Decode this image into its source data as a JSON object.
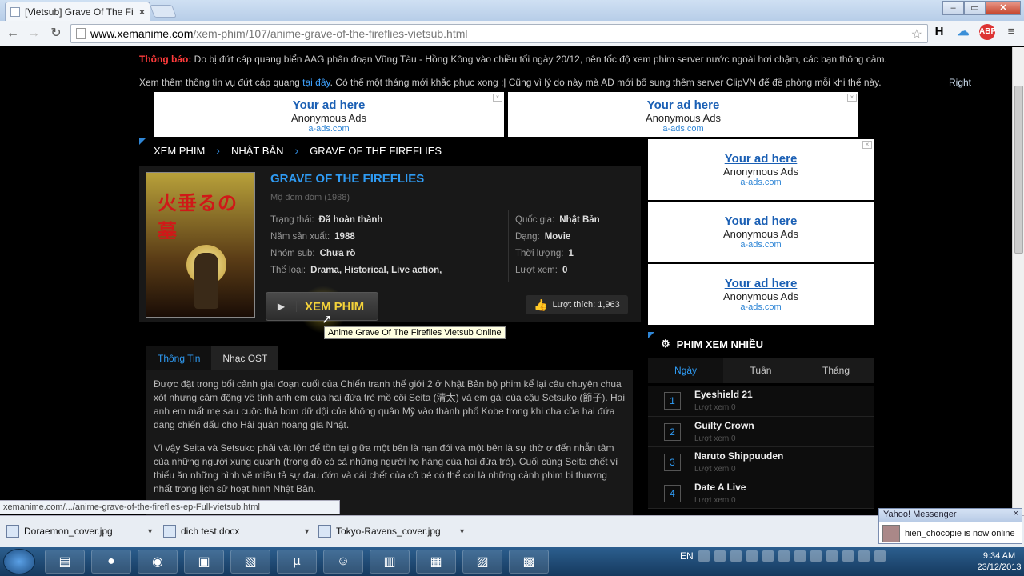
{
  "browser": {
    "tab_title": "[Vietsub] Grave Of The Fireflies",
    "url_host": "www.xemanime.com",
    "url_path": "/xem-phim/107/anime-grave-of-the-fireflies-vietsub.html",
    "window_buttons": [
      "–",
      "▭",
      "✕"
    ]
  },
  "notice": {
    "label": "Thông báo:",
    "text": "Do bị đứt cáp quang biển AAG phân đoạn Vũng Tàu - Hồng Kông vào chiều tối ngày 20/12, nên tốc độ xem phim server nước ngoài hơi chậm, các bạn thông cảm.",
    "line2_before": "Xem thêm thông tin vụ đứt cáp quang ",
    "line2_link": "tại đây",
    "line2_after": ". Có thể một tháng mới khắc phục xong :| Cũng vì lý do này mà AD mới bổ sung thêm server ClipVN để đề phòng mỗi khi thế này.",
    "right_label": "Right"
  },
  "ad": {
    "line1": "Your ad here",
    "line2": "Anonymous Ads",
    "line3": "a-ads.com"
  },
  "breadcrumb": [
    "XEM PHIM",
    "NHẬT BẢN",
    "GRAVE OF THE FIREFLIES"
  ],
  "film": {
    "title": "GRAVE OF THE FIREFLIES",
    "subtitle": "Mộ đom đóm (1988)",
    "poster_jp": "火垂るの墓",
    "left_fields": [
      {
        "label": "Trạng thái:",
        "value": "Đã hoàn thành"
      },
      {
        "label": "Năm sản xuất:",
        "value": "1988"
      },
      {
        "label": "Nhóm sub:",
        "value": "Chưa rõ"
      },
      {
        "label": "Thể loại:",
        "value": "Drama, Historical, Live action,"
      }
    ],
    "right_fields": [
      {
        "label": "Quốc gia:",
        "value": "Nhật Bản"
      },
      {
        "label": "Dạng:",
        "value": "Movie"
      },
      {
        "label": "Thời lượng:",
        "value": "1"
      },
      {
        "label": "Lượt xem:",
        "value": "0"
      }
    ],
    "watch_label": "XEM PHIM",
    "tooltip": "Anime Grave Of The Fireflies Vietsub Online",
    "likes_label": "Lượt thích: 1,963"
  },
  "content_tabs": [
    "Thông Tin",
    "Nhạc OST"
  ],
  "description": [
    "Được đặt trong bối cảnh giai đoạn cuối của Chiến tranh thế giới 2 ở Nhật Bản bộ phim kể lại câu chuyện chua xót nhưng cảm động về tình anh em của hai đứa trẻ mồ côi Seita (清太) và em gái của cậu Setsuko (節子). Hai anh em mất mẹ sau cuộc thả bom dữ dội của không quân Mỹ vào thành phố Kobe trong khi cha của hai đứa đang chiến đấu cho Hải quân hoàng gia Nhật.",
    "Vì vậy Seita và Setsuko phải vật lộn để tồn tại giữa một bên là nạn đói và một bên là sự thờ ơ đến nhẫn tâm của những người xung quanh (trong đó có cả những người họ hàng của hai đứa trẻ). Cuối cùng Seita chết vì thiếu ăn những hình vẽ miêu tả sự đau đớn và cái chết của cô bé có thể coi là những cảnh phim bi thương nhất trong lịch sử hoạt hình Nhật Bản."
  ],
  "popular": {
    "heading": "PHIM XEM NHIỀU",
    "periods": [
      "Ngày",
      "Tuần",
      "Tháng"
    ],
    "items": [
      {
        "num": "1",
        "name": "Eyeshield 21",
        "views": "Lượt xem 0"
      },
      {
        "num": "2",
        "name": "Guilty Crown",
        "views": "Lượt xem 0"
      },
      {
        "num": "3",
        "name": "Naruto Shippuuden",
        "views": "Lượt xem 0"
      },
      {
        "num": "4",
        "name": "Date A Live",
        "views": "Lượt xem 0"
      }
    ]
  },
  "status_url": "xemanime.com/.../anime-grave-of-the-fireflies-ep-Full-vietsub.html",
  "downloads": [
    "Doraemon_cover.jpg",
    "dich test.docx",
    "Tokyo-Ravens_cover.jpg"
  ],
  "yahoo": {
    "title": "Yahoo! Messenger",
    "message": "hien_chocopie is now online"
  },
  "taskbar": {
    "lang": "EN",
    "time": "9:34 AM",
    "date": "23/12/2013"
  }
}
